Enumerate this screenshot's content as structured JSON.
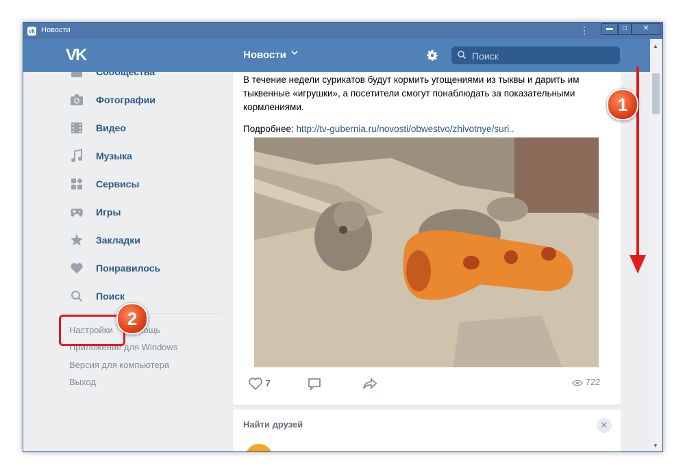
{
  "window": {
    "title": "Новости"
  },
  "header": {
    "logo": "VK",
    "title": "Новости",
    "search_placeholder": "Поиск"
  },
  "sidebar": {
    "items": [
      {
        "label": "Сообщества",
        "icon": "groups-icon"
      },
      {
        "label": "Фотографии",
        "icon": "camera-icon"
      },
      {
        "label": "Видео",
        "icon": "video-icon"
      },
      {
        "label": "Музыка",
        "icon": "music-icon"
      },
      {
        "label": "Сервисы",
        "icon": "services-icon"
      },
      {
        "label": "Игры",
        "icon": "gamepad-icon"
      },
      {
        "label": "Закладки",
        "icon": "star-icon"
      },
      {
        "label": "Понравилось",
        "icon": "heart-icon"
      },
      {
        "label": "Поиск",
        "icon": "search-icon"
      }
    ],
    "footer_links": [
      "Настройки",
      "Помощь",
      "Приложение для Windows",
      "Версия для компьютера",
      "Выход"
    ]
  },
  "post": {
    "text": "В течение недели сурикатов будут кормить угощениями из тыквы и дарить им тыквенные «игрушки», а посетители смогут понаблюдать за показательными кормлениями.",
    "more_label": "Подробнее:",
    "link": "http://tv-gubernia.ru/novosti/obwestvo/zhivotnye/suri..",
    "likes": "7",
    "views": "722"
  },
  "friends_card": {
    "title": "Найти друзей",
    "close": "✕"
  },
  "annotations": {
    "step1": "1",
    "step2": "2",
    "accent": "#e21b1b"
  }
}
